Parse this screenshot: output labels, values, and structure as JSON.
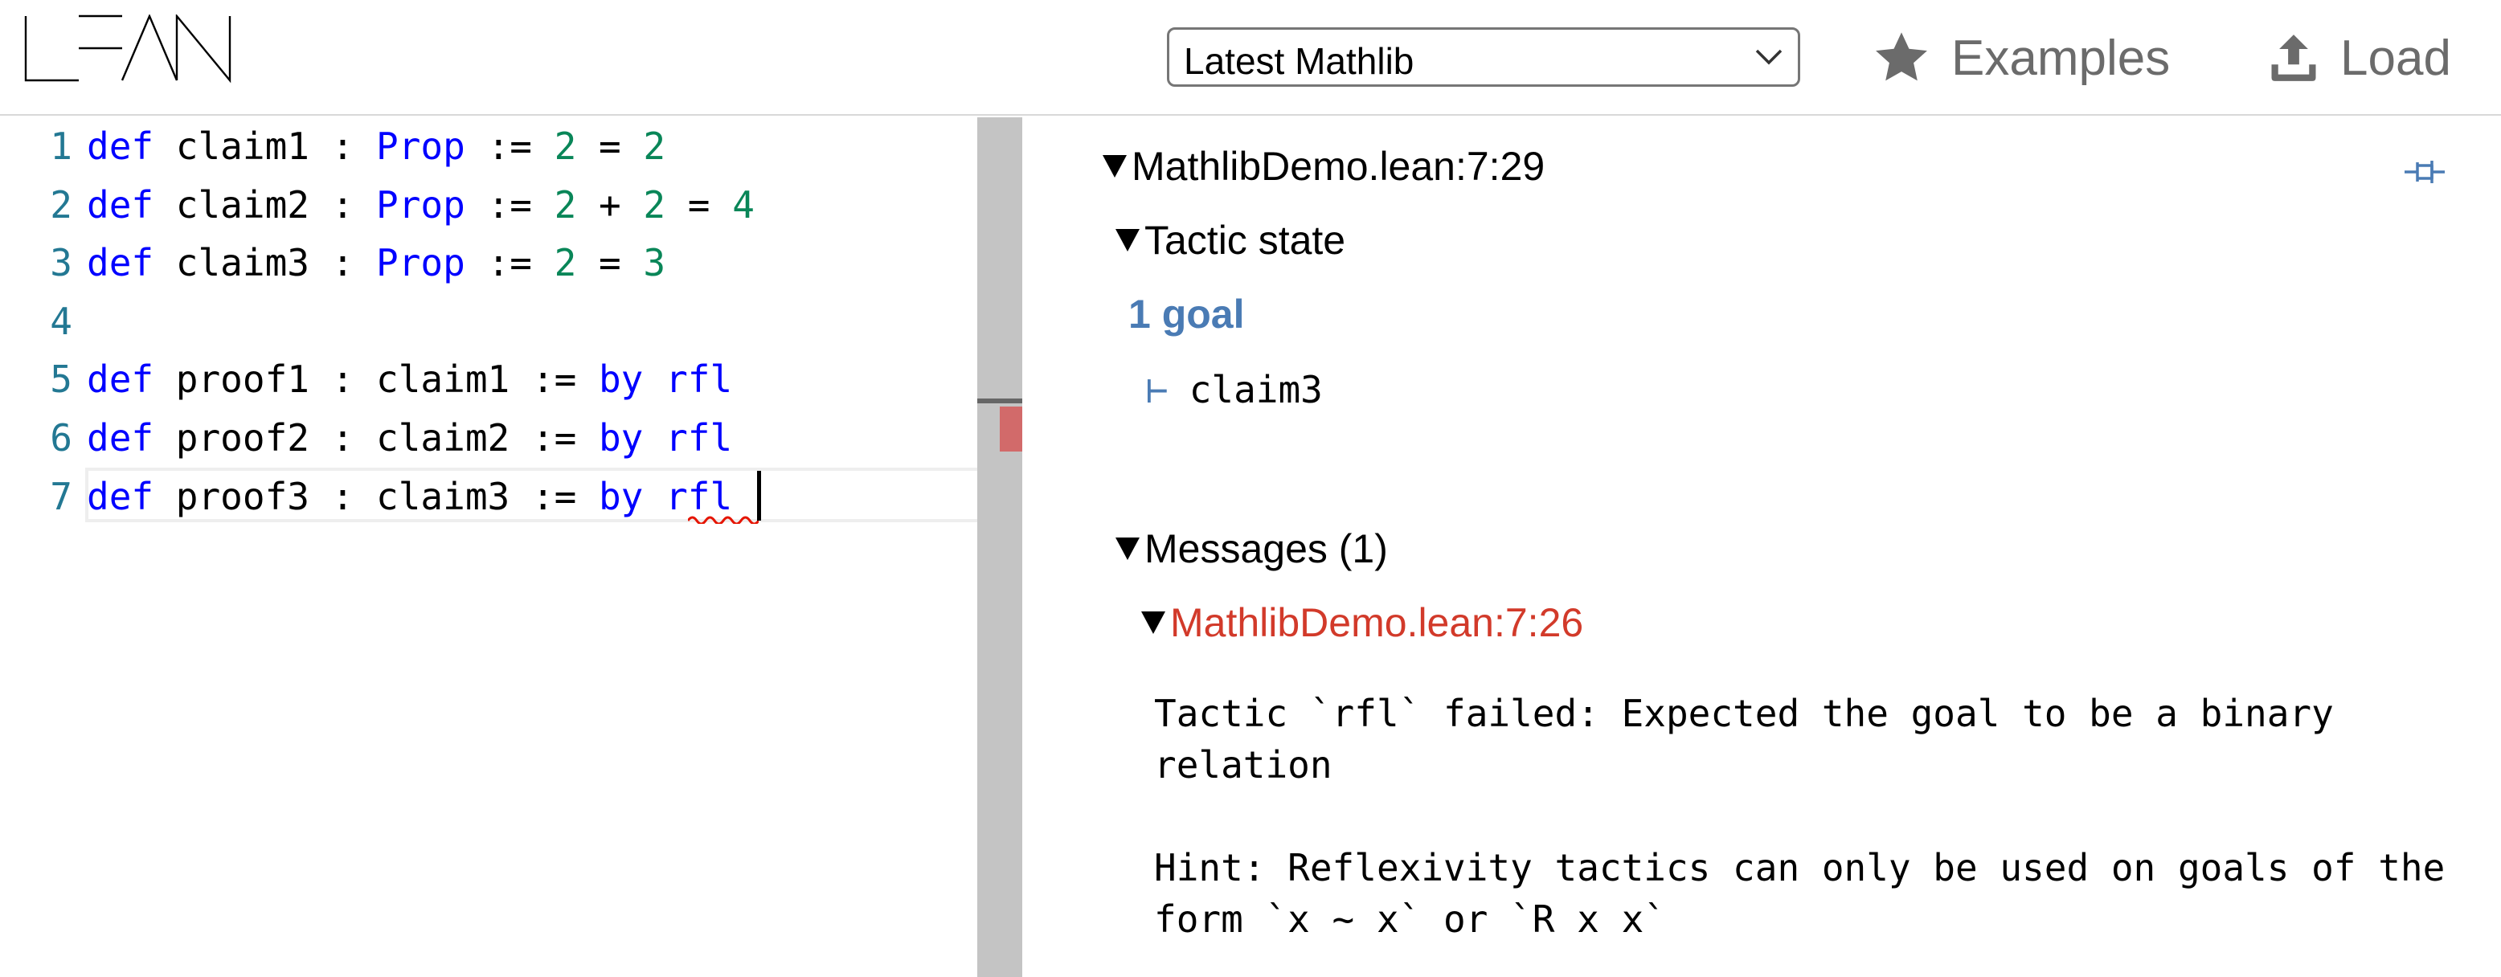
{
  "header": {
    "logo_text": "LEAN",
    "version_select": {
      "selected": "Latest Mathlib"
    },
    "examples_label": "Examples",
    "load_label": "Load"
  },
  "editor": {
    "lines": [
      {
        "num": "1",
        "tokens": [
          {
            "t": "def",
            "k": "kw"
          },
          {
            "t": " claim1 : "
          },
          {
            "t": "Prop",
            "k": "kw"
          },
          {
            "t": " := "
          },
          {
            "t": "2",
            "k": "num"
          },
          {
            "t": " = "
          },
          {
            "t": "2",
            "k": "num"
          }
        ]
      },
      {
        "num": "2",
        "tokens": [
          {
            "t": "def",
            "k": "kw"
          },
          {
            "t": " claim2 : "
          },
          {
            "t": "Prop",
            "k": "kw"
          },
          {
            "t": " := "
          },
          {
            "t": "2",
            "k": "num"
          },
          {
            "t": " + "
          },
          {
            "t": "2",
            "k": "num"
          },
          {
            "t": " = "
          },
          {
            "t": "4",
            "k": "num"
          }
        ]
      },
      {
        "num": "3",
        "tokens": [
          {
            "t": "def",
            "k": "kw"
          },
          {
            "t": " claim3 : "
          },
          {
            "t": "Prop",
            "k": "kw"
          },
          {
            "t": " := "
          },
          {
            "t": "2",
            "k": "num"
          },
          {
            "t": " = "
          },
          {
            "t": "3",
            "k": "num"
          }
        ]
      },
      {
        "num": "4",
        "tokens": []
      },
      {
        "num": "5",
        "tokens": [
          {
            "t": "def",
            "k": "kw"
          },
          {
            "t": " proof1 : claim1 := "
          },
          {
            "t": "by",
            "k": "kw"
          },
          {
            "t": " "
          },
          {
            "t": "rfl",
            "k": "kw"
          }
        ]
      },
      {
        "num": "6",
        "tokens": [
          {
            "t": "def",
            "k": "kw"
          },
          {
            "t": " proof2 : claim2 := "
          },
          {
            "t": "by",
            "k": "kw"
          },
          {
            "t": " "
          },
          {
            "t": "rfl",
            "k": "kw"
          }
        ]
      },
      {
        "num": "7",
        "tokens": [
          {
            "t": "def",
            "k": "kw"
          },
          {
            "t": " proof3 : claim3 := "
          },
          {
            "t": "by",
            "k": "kw"
          },
          {
            "t": " "
          },
          {
            "t": "rfl",
            "k": "kw"
          }
        ]
      }
    ]
  },
  "infoview": {
    "position_header": "MathlibDemo.lean:7:29",
    "tactic_state_label": "Tactic state",
    "goal_count": "1 goal",
    "turnstile": "⊢",
    "goal": "claim3",
    "messages_label": "Messages (1)",
    "message": {
      "position": "MathlibDemo.lean:7:26",
      "text": "Tactic `rfl` failed: Expected the goal to be a binary\nrelation\n\nHint: Reflexivity tactics can only be used on goals of the\nform `x ~ x` or `R x x`"
    }
  },
  "colors": {
    "keyword": "#0000ff",
    "number": "#098658",
    "line_number": "#237893",
    "goal_accent": "#4a7bb4",
    "error": "#d23a2a"
  },
  "icons": {
    "examples": "star-icon",
    "load": "upload-icon",
    "pin": "pin-icon",
    "select": "chevron-down-icon"
  }
}
